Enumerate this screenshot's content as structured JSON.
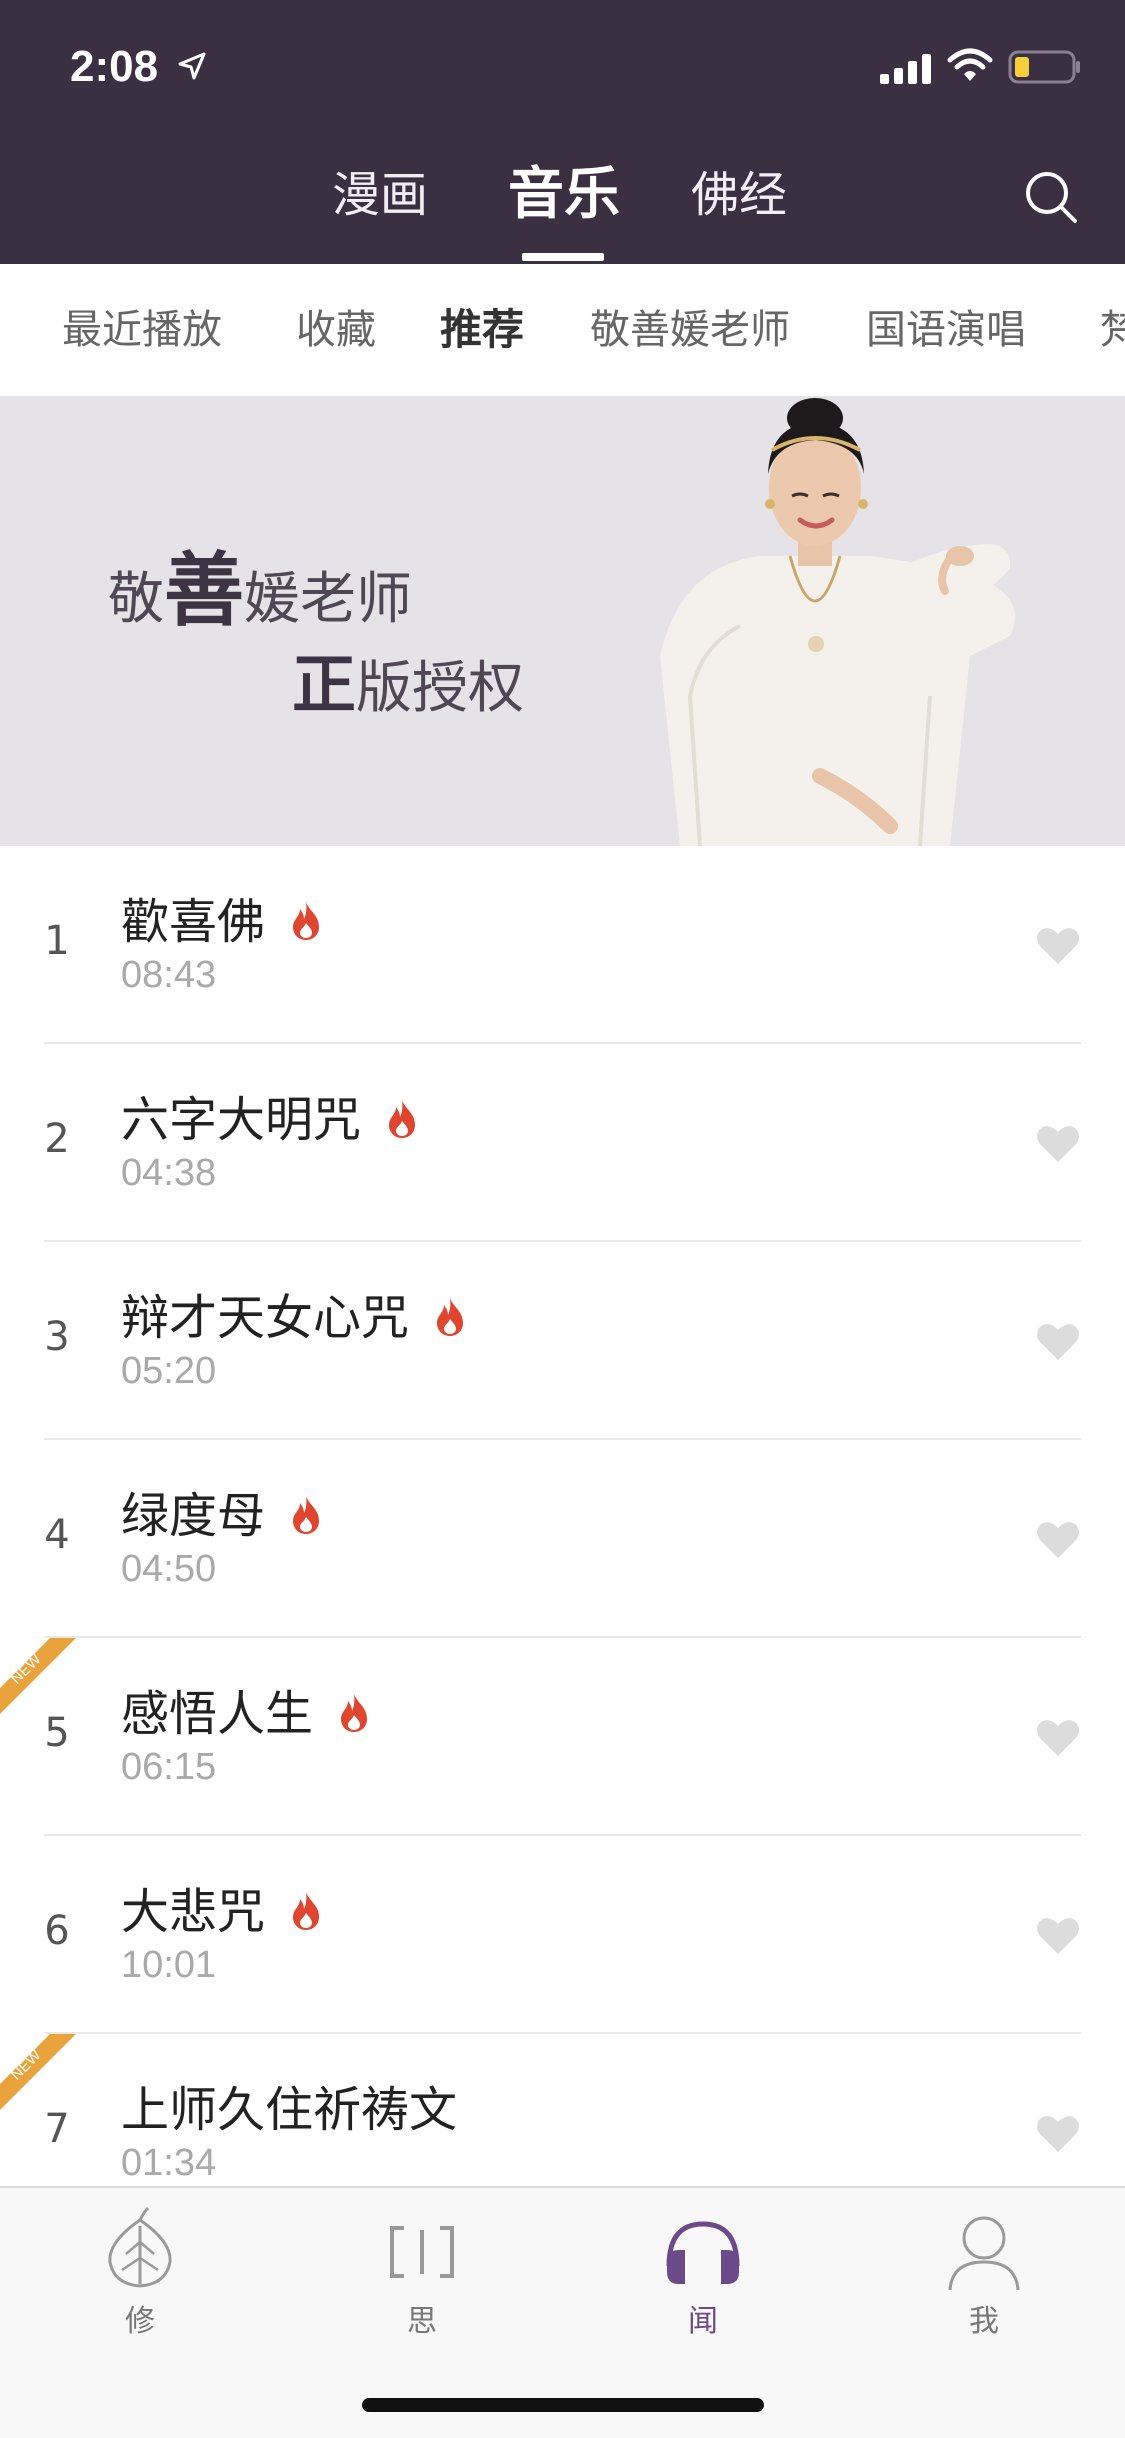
{
  "status": {
    "time": "2:08"
  },
  "main_tabs": [
    {
      "label": "漫画"
    },
    {
      "label": "音乐"
    },
    {
      "label": "佛经"
    }
  ],
  "sub_tabs": [
    {
      "label": "最近播放"
    },
    {
      "label": "收藏"
    },
    {
      "label": "推荐"
    },
    {
      "label": "敬善媛老师"
    },
    {
      "label": "国语演唱"
    },
    {
      "label": "梵"
    }
  ],
  "banner": {
    "line1_a": "敬",
    "line1_b": "善",
    "line1_c": "媛老师",
    "line2_a": "正",
    "line2_b": "版授权"
  },
  "tracks": [
    {
      "num": "1",
      "title": "歡喜佛",
      "duration": "08:43",
      "hot": true,
      "new": false
    },
    {
      "num": "2",
      "title": "六字大明咒",
      "duration": "04:38",
      "hot": true,
      "new": false
    },
    {
      "num": "3",
      "title": "辩才天女心咒",
      "duration": "05:20",
      "hot": true,
      "new": false
    },
    {
      "num": "4",
      "title": "绿度母",
      "duration": "04:50",
      "hot": true,
      "new": false
    },
    {
      "num": "5",
      "title": "感悟人生",
      "duration": "06:15",
      "hot": true,
      "new": true
    },
    {
      "num": "6",
      "title": "大悲咒",
      "duration": "10:01",
      "hot": true,
      "new": false
    },
    {
      "num": "7",
      "title": "上师久住祈祷文",
      "duration": "01:34",
      "hot": false,
      "new": true
    }
  ],
  "badge_label": "NEW",
  "bottom_nav": [
    {
      "label": "修",
      "icon": "bodhi-leaf-icon"
    },
    {
      "label": "思",
      "icon": "brackets-icon"
    },
    {
      "label": "闻",
      "icon": "headphones-icon"
    },
    {
      "label": "我",
      "icon": "person-icon"
    }
  ],
  "colors": {
    "header_bg": "#3b2f42",
    "accent": "#6b4a8a",
    "flame": "#e0462f",
    "new_badge": "#e8a33c"
  }
}
